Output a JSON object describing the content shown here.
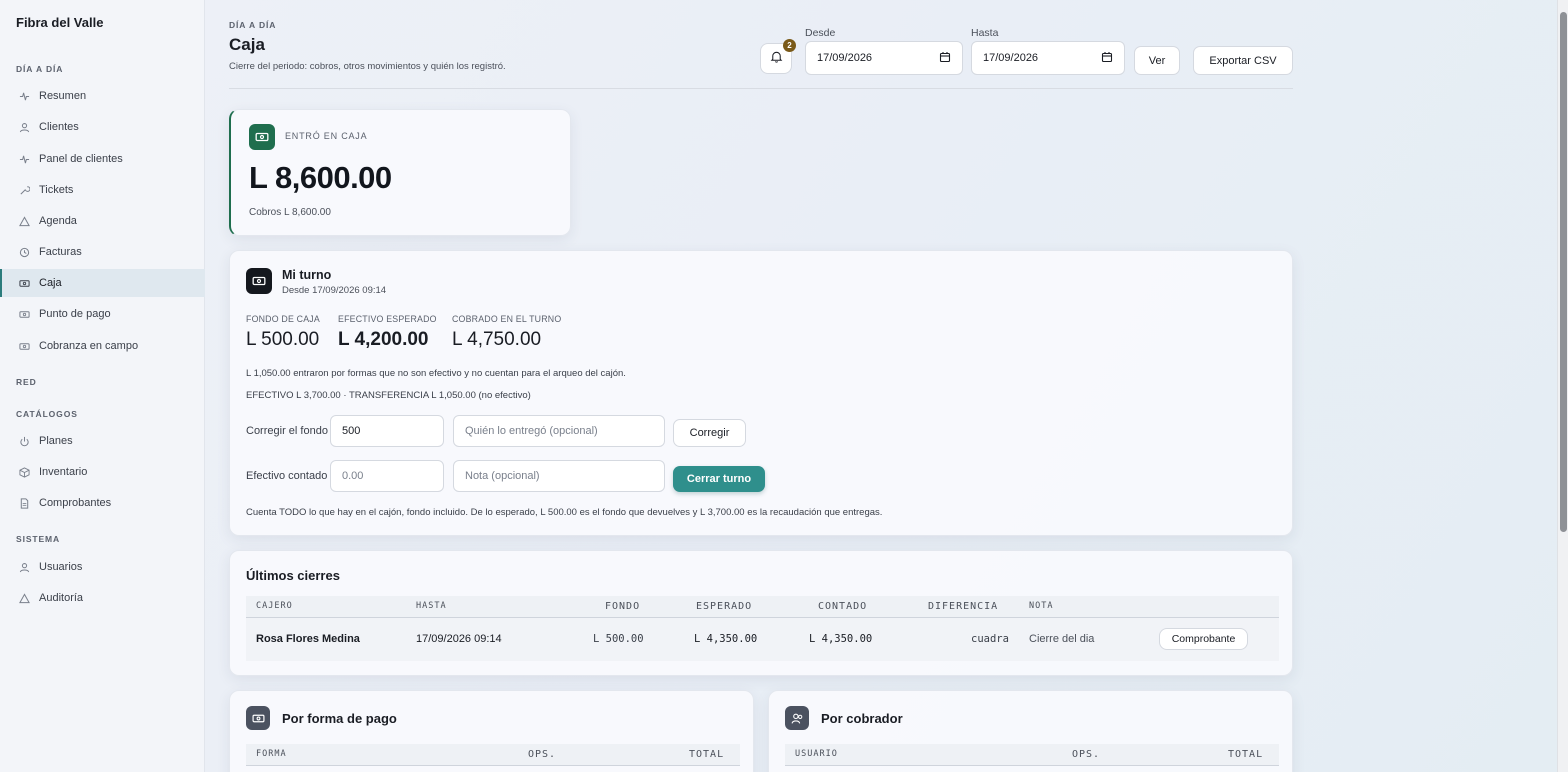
{
  "sidebar": {
    "brand": "Fibra del Valle",
    "sections": {
      "dia": "DÍA A DÍA",
      "red": "RED",
      "catalogos": "CATÁLOGOS",
      "sistema": "SISTEMA"
    },
    "items": [
      {
        "label": "Resumen",
        "icon": "pulse-icon"
      },
      {
        "label": "Clientes",
        "icon": "user-icon"
      },
      {
        "label": "Panel de clientes",
        "icon": "pulse-icon"
      },
      {
        "label": "Tickets",
        "icon": "wrench-icon"
      },
      {
        "label": "Agenda",
        "icon": "warning-icon"
      },
      {
        "label": "Facturas",
        "icon": "clock-icon"
      },
      {
        "label": "Caja",
        "icon": "cash-icon",
        "active": true
      },
      {
        "label": "Punto de pago",
        "icon": "cash-icon"
      },
      {
        "label": "Cobranza en campo",
        "icon": "cash-icon"
      },
      {
        "label": "Planes",
        "icon": "power-icon"
      },
      {
        "label": "Inventario",
        "icon": "box-icon"
      },
      {
        "label": "Comprobantes",
        "icon": "document-icon"
      },
      {
        "label": "Usuarios",
        "icon": "user-icon"
      },
      {
        "label": "Auditoría",
        "icon": "warning-icon"
      }
    ]
  },
  "header": {
    "eyebrow": "DÍA A DÍA",
    "title": "Caja",
    "subtitle": "Cierre del periodo: cobros, otros movimientos y quién los registró.",
    "notifications": "2",
    "desde_label": "Desde",
    "desde_value": "17/09/2026",
    "hasta_label": "Hasta",
    "hasta_value": "17/09/2026",
    "ver_label": "Ver",
    "export_label": "Exportar CSV"
  },
  "kpi": {
    "label": "ENTRÓ EN CAJA",
    "value": "L 8,600.00",
    "sub": "Cobros L 8,600.00"
  },
  "turno": {
    "title": "Mi turno",
    "since": "Desde 17/09/2026 09:14",
    "fondo_label": "FONDO DE CAJA",
    "fondo_value": "L 500.00",
    "esperado_label": "EFECTIVO ESPERADO",
    "esperado_value": "L 4,200.00",
    "cobrado_label": "COBRADO EN EL TURNO",
    "cobrado_value": "L 4,750.00",
    "note1": "L 1,050.00 entraron por formas que no son efectivo y no cuentan para el arqueo del cajón.",
    "note2": "EFECTIVO L 3,700.00 · TRANSFERENCIA L 1,050.00 (no efectivo)",
    "corregir_label": "Corregir el fondo",
    "corregir_value": "500",
    "quien_placeholder": "Quién lo entregó (opcional)",
    "corregir_btn": "Corregir",
    "contado_label": "Efectivo contado",
    "contado_placeholder": "0.00",
    "nota_placeholder": "Nota (opcional)",
    "cerrar_btn": "Cerrar turno",
    "footer": "Cuenta TODO lo que hay en el cajón, fondo incluido. De lo esperado, L 500.00 es el fondo que devuelves y L 3,700.00 es la recaudación que entregas."
  },
  "cierres": {
    "title": "Últimos cierres",
    "columns": [
      "CAJERO",
      "HASTA",
      "FONDO",
      "ESPERADO",
      "CONTADO",
      "DIFERENCIA",
      "NOTA"
    ],
    "rows": [
      {
        "cajero": "Rosa Flores Medina",
        "hasta": "17/09/2026 09:14",
        "fondo": "L 500.00",
        "esperado": "L 4,350.00",
        "contado": "L 4,350.00",
        "diferencia": "cuadra",
        "nota": "Cierre del dia",
        "action": "Comprobante"
      }
    ]
  },
  "forma_pago": {
    "title": "Por forma de pago",
    "columns": [
      "FORMA",
      "OPS.",
      "TOTAL"
    ]
  },
  "cobrador": {
    "title": "Por cobrador",
    "columns": [
      "USUARIO",
      "OPS.",
      "TOTAL"
    ]
  },
  "colors": {
    "accent": "#2f8f8c",
    "kpi_green": "#1f6e4e",
    "badge": "#7a5a19"
  }
}
